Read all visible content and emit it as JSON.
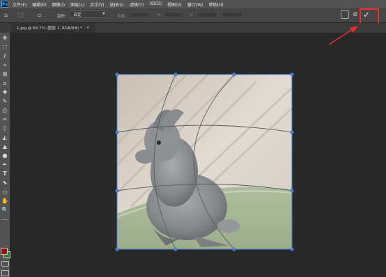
{
  "app": {
    "logo_text": "Ps"
  },
  "menu": [
    "文件(F)",
    "编辑(E)",
    "图像(I)",
    "图层(L)",
    "文字(Y)",
    "选择(S)",
    "滤镜(T)",
    "3D(D)",
    "视图(V)",
    "窗口(W)",
    "帮助(H)"
  ],
  "options_bar": {
    "warp_label": "变形:",
    "warp_value": "自定",
    "bend_label": "弯曲:",
    "h_label": "H:",
    "v_label": "V:"
  },
  "document_tab": {
    "title": "1.jpg @ 66.7% (图层 1, RGB/8#) *",
    "close": "×"
  },
  "tools": [
    "✥",
    "⬚",
    "ℓ",
    "⌖",
    "⊠",
    "⌂",
    "✚",
    "✎",
    "⎙",
    "✂",
    "⬯",
    "◭",
    "▲",
    "●",
    "✒",
    "T",
    "⬉",
    "▭",
    "✋",
    "🔍",
    "⋯"
  ],
  "actions": {
    "commit_icon": "checkmark-icon",
    "cancel_icon": "cancel-icon"
  },
  "colors": {
    "annotation_red": "#e2302d",
    "handle_blue": "#4a7fd4",
    "foreground": "#8c1515",
    "background": "#2f7c2f"
  }
}
